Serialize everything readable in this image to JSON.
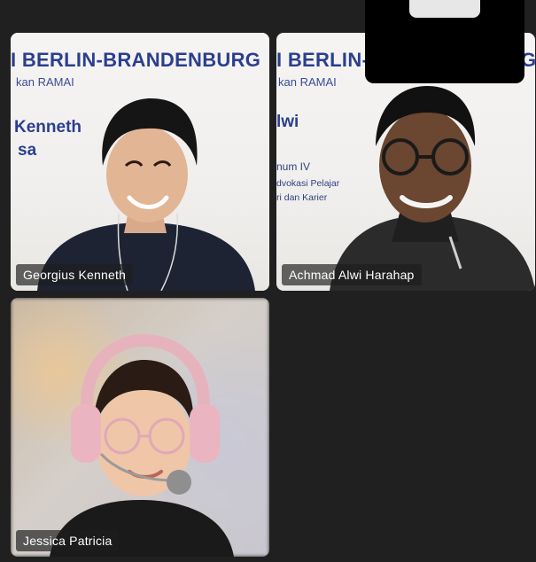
{
  "participants": [
    {
      "name": "Georgius Kenneth",
      "active_speaker": true
    },
    {
      "name": "Achmad Alwi Harahap",
      "active_speaker": false
    },
    {
      "name": "Jessica Patricia",
      "active_speaker": false
    }
  ],
  "backdrop_1": {
    "title": "I BERLIN-BRANDENBURG",
    "subtitle": "kan RAMAI",
    "name_line1": "Kenneth",
    "name_line2": "sa"
  },
  "backdrop_2": {
    "title": "I BERLIN-",
    "title_tail": "G",
    "subtitle": "kan RAMAI",
    "name": "lwi",
    "line1": "num IV",
    "line2": "dvokasi Pelajar",
    "line3": "ri dan Karier"
  },
  "colors": {
    "active_border": "#3fd06a",
    "backdrop_text": "#2a3f8f",
    "background": "#202020"
  }
}
